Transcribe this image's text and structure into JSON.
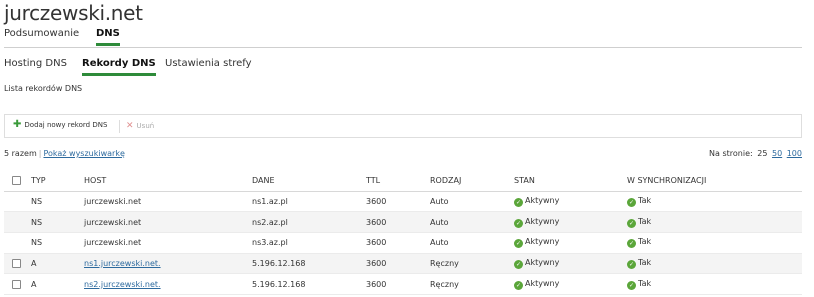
{
  "page": {
    "title": "jurczewski.net"
  },
  "tabs_primary": [
    {
      "label": "Podsumowanie",
      "active": false
    },
    {
      "label": "DNS",
      "active": true
    }
  ],
  "tabs_secondary": [
    {
      "label": "Hosting DNS",
      "active": false
    },
    {
      "label": "Rekordy DNS",
      "active": true
    },
    {
      "label": "Ustawienia strefy",
      "active": false
    }
  ],
  "section_title": "Lista rekordów DNS",
  "toolbar": {
    "add_label": "Dodaj nowy rekord DNS",
    "delete_label": "Usuń",
    "add_icon": "plus-icon",
    "delete_icon": "x-icon"
  },
  "summary": {
    "count": "5 razem",
    "search_link": "Pokaż wyszukiwarkę"
  },
  "per_page": {
    "label": "Na stronie:",
    "options": [
      "25",
      "50",
      "100"
    ],
    "selected": "25"
  },
  "table": {
    "headers": [
      "TYP",
      "HOST",
      "DANE",
      "TTL",
      "RODZAJ",
      "STAN",
      "W SYNCHRONIZACJI"
    ],
    "rows": [
      {
        "checkbox": false,
        "typ": "NS",
        "host": "jurczewski.net",
        "host_link": false,
        "dane": "ns1.az.pl",
        "ttl": "3600",
        "rodzaj": "Auto",
        "stan": "Aktywny",
        "sync": "Tak"
      },
      {
        "checkbox": false,
        "typ": "NS",
        "host": "jurczewski.net",
        "host_link": false,
        "dane": "ns2.az.pl",
        "ttl": "3600",
        "rodzaj": "Auto",
        "stan": "Aktywny",
        "sync": "Tak"
      },
      {
        "checkbox": false,
        "typ": "NS",
        "host": "jurczewski.net",
        "host_link": false,
        "dane": "ns3.az.pl",
        "ttl": "3600",
        "rodzaj": "Auto",
        "stan": "Aktywny",
        "sync": "Tak"
      },
      {
        "checkbox": true,
        "typ": "A",
        "host": "ns1.jurczewski.net.",
        "host_link": true,
        "dane": "5.196.12.168",
        "ttl": "3600",
        "rodzaj": "Ręczny",
        "stan": "Aktywny",
        "sync": "Tak"
      },
      {
        "checkbox": true,
        "typ": "A",
        "host": "ns2.jurczewski.net.",
        "host_link": true,
        "dane": "5.196.12.168",
        "ttl": "3600",
        "rodzaj": "Ręczny",
        "stan": "Aktywny",
        "sync": "Tak"
      }
    ]
  },
  "colors": {
    "accent": "#2e8b3a",
    "link": "#2d6a9e",
    "status_ok": "#5ba63a"
  }
}
